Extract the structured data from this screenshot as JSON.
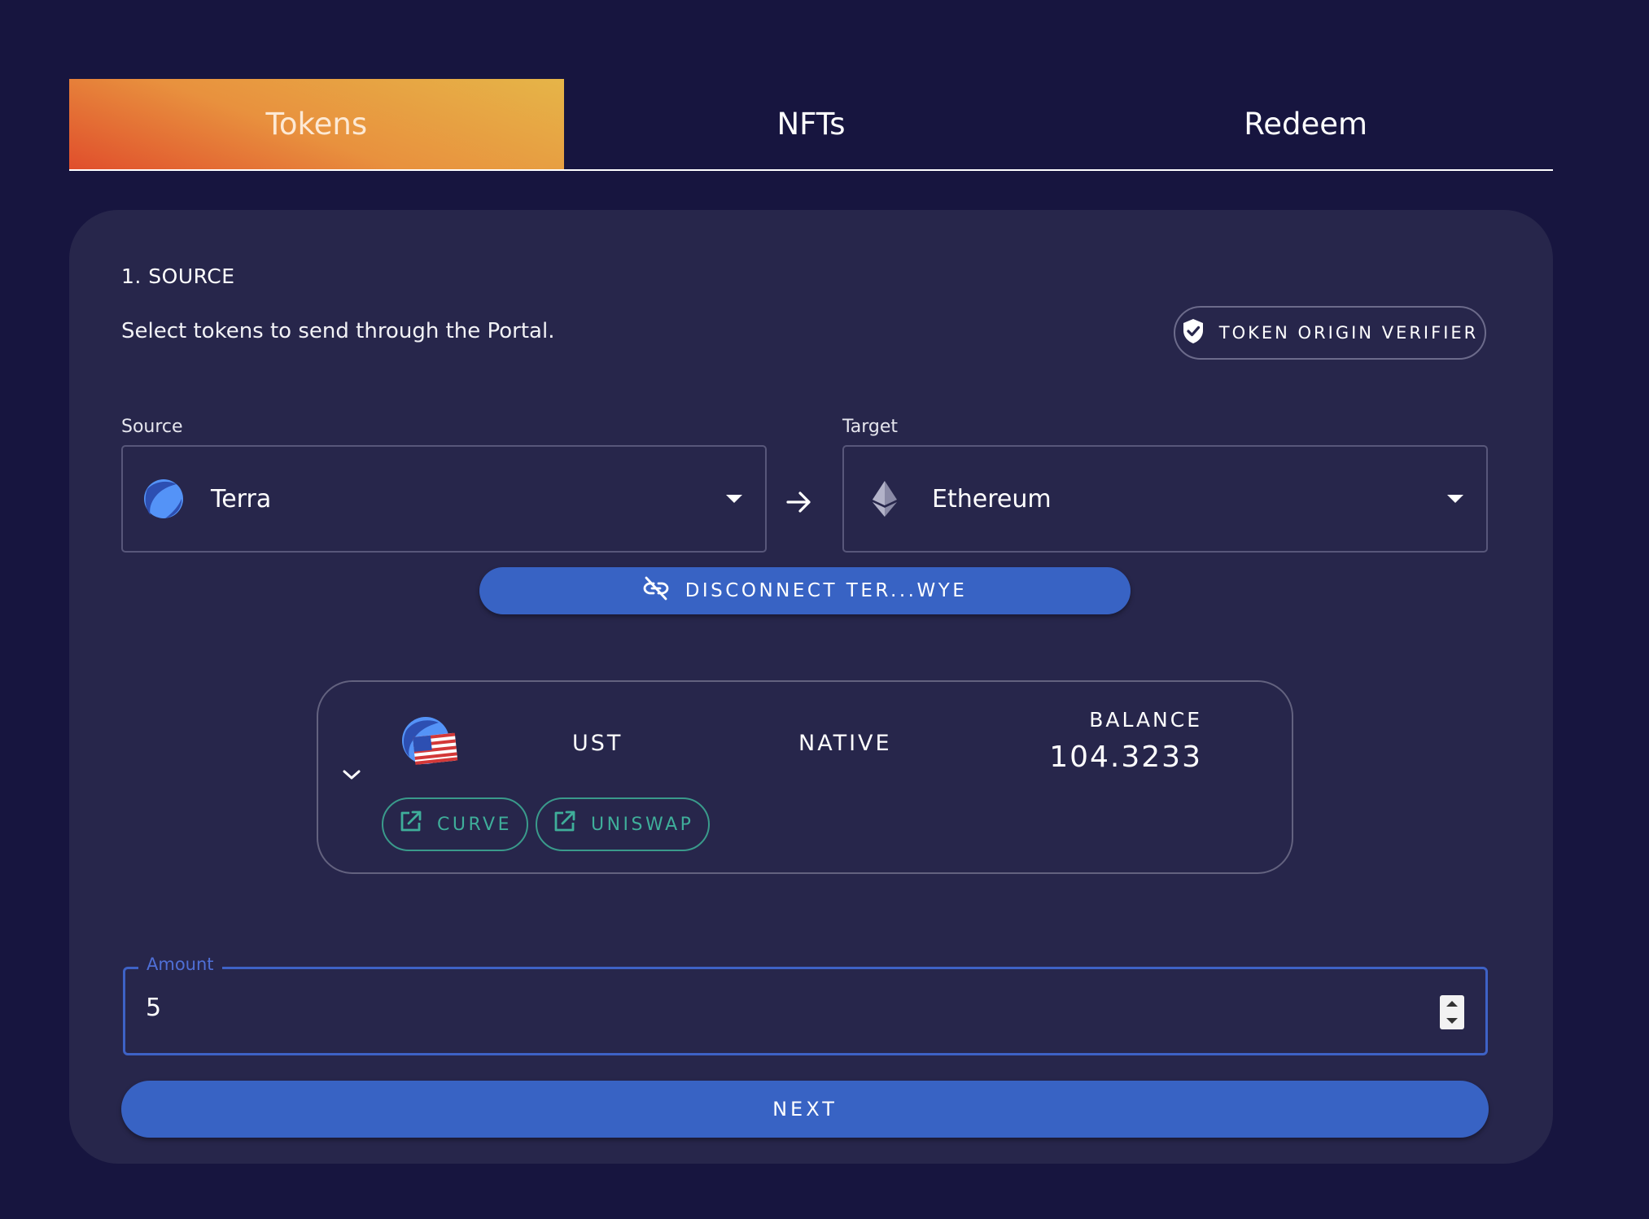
{
  "tabs": [
    {
      "label": "Tokens",
      "active": true
    },
    {
      "label": "NFTs",
      "active": false
    },
    {
      "label": "Redeem",
      "active": false
    }
  ],
  "section": {
    "title": "1. SOURCE",
    "subtitle": "Select tokens to send through the Portal.",
    "verifier_label": "TOKEN ORIGIN VERIFIER",
    "verifier_icon": "shield-check-icon"
  },
  "source": {
    "label": "Source",
    "value": "Terra",
    "icon": "terra-logo-icon"
  },
  "target": {
    "label": "Target",
    "value": "Ethereum",
    "icon": "ethereum-logo-icon"
  },
  "disconnect": {
    "label": "DISCONNECT TER...WYE",
    "icon": "link-off-icon"
  },
  "token": {
    "symbol": "UST",
    "type": "NATIVE",
    "balance_label": "BALANCE",
    "balance": "104.3233",
    "links": [
      {
        "label": "CURVE",
        "icon": "open-in-new-icon"
      },
      {
        "label": "UNISWAP",
        "icon": "open-in-new-icon"
      }
    ]
  },
  "amount": {
    "label": "Amount",
    "value": "5"
  },
  "next": {
    "label": "NEXT"
  },
  "colors": {
    "background": "#17153f",
    "card": "#27264b",
    "primary": "#3863c4",
    "teal": "#3fae9a",
    "tab_gradient_start": "#e04e2c",
    "tab_gradient_end": "#e6b548"
  }
}
